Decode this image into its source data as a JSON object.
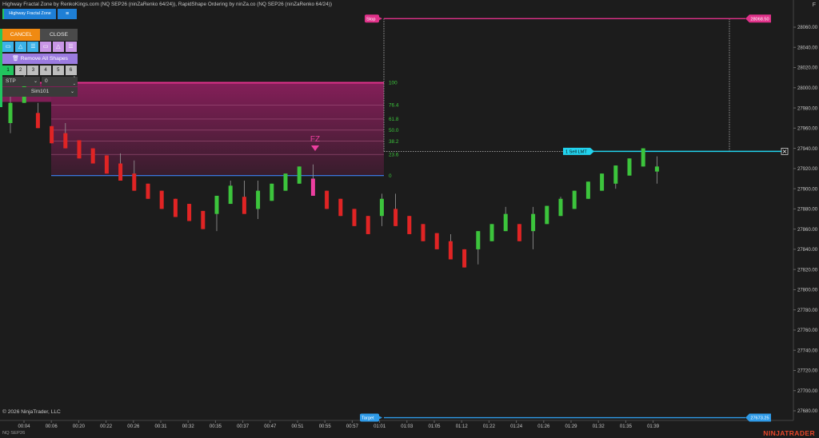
{
  "header": {
    "indicators_line": "Highway Fractal Zone by RenkoKings.com (NQ SEP26 (ninZaRenko 64/24)), RapidShape Ordering by ninZa.co (NQ SEP26 (ninZaRenko 64/24))",
    "corner_label": "F"
  },
  "panel": {
    "hfz_label": "Highway Fractal Zone",
    "hfz_menu_icon": "hamburger-icon",
    "cancel_label": "CANCEL",
    "close_label": "CLOSE",
    "tools": [
      {
        "icon": "rectangle-icon",
        "color": "#3bb2e8"
      },
      {
        "icon": "triangle-icon",
        "color": "#3bb2e8"
      },
      {
        "icon": "lines-icon",
        "color": "#3bb2e8"
      },
      {
        "icon": "rectangle-icon",
        "color": "#c996e6"
      },
      {
        "icon": "triangle-icon",
        "color": "#c996e6"
      },
      {
        "icon": "lines-icon",
        "color": "#c996e6"
      }
    ],
    "remove_label": "Remove All Shapes",
    "numbers": [
      "1",
      "2",
      "3",
      "4",
      "5",
      "6"
    ],
    "active_number": "1",
    "order_type": "STP",
    "quantity": "0",
    "account": "Sim101"
  },
  "footer": {
    "copyright": "© 2026 NinjaTrader, LLC",
    "instrument": "NQ SEP26",
    "brand": "NINJATRADER"
  },
  "chart_data": {
    "type": "renko",
    "instrument": "NQ SEP26",
    "y_axis": {
      "min": 27680,
      "max": 28080,
      "ticks": [
        28060,
        28040,
        28020,
        28000,
        27980,
        27960,
        27940,
        27920,
        27900,
        27880,
        27860,
        27840,
        27820,
        27800,
        27780,
        27760,
        27740,
        27720,
        27700,
        27680
      ],
      "tick_labels": [
        "28060.00",
        "28040.00",
        "28020.00",
        "28000.00",
        "27980.00",
        "27960.00",
        "27940.00",
        "27920.00",
        "27900.00",
        "27880.00",
        "27860.00",
        "27840.00",
        "27820.00",
        "27800.00",
        "27780.00",
        "27760.00",
        "27740.00",
        "27720.00",
        "27700.00",
        "27680.00"
      ]
    },
    "x_tick_labels": [
      "00:04",
      "00:06",
      "00:20",
      "00:22",
      "00:26",
      "00:31",
      "00:32",
      "00:35",
      "00:37",
      "00:47",
      "00:51",
      "00:55",
      "00:57",
      "01:01",
      "01:03",
      "01:05",
      "01:12",
      "01:22",
      "01:24",
      "01:26",
      "01:29",
      "01:32",
      "01:35",
      "01:39"
    ],
    "bars": [
      {
        "d": "up",
        "o": 27965,
        "c": 27985,
        "h": 27995,
        "l": 27955
      },
      {
        "d": "up",
        "o": 27985,
        "c": 28005,
        "h": 28015,
        "l": 27985
      },
      {
        "d": "down",
        "o": 27975,
        "c": 27960,
        "h": 27985,
        "l": 27960
      },
      {
        "d": "down",
        "o": 27962,
        "c": 27945,
        "h": 27962,
        "l": 27945
      },
      {
        "d": "down",
        "o": 27955,
        "c": 27940,
        "h": 27965,
        "l": 27940
      },
      {
        "d": "down",
        "o": 27948,
        "c": 27930,
        "h": 27948,
        "l": 27930
      },
      {
        "d": "down",
        "o": 27940,
        "c": 27925,
        "h": 27940,
        "l": 27925
      },
      {
        "d": "down",
        "o": 27933,
        "c": 27915,
        "h": 27933,
        "l": 27915
      },
      {
        "d": "down",
        "o": 27925,
        "c": 27908,
        "h": 27935,
        "l": 27908
      },
      {
        "d": "down",
        "o": 27915,
        "c": 27898,
        "h": 27928,
        "l": 27898
      },
      {
        "d": "down",
        "o": 27905,
        "c": 27890,
        "h": 27905,
        "l": 27890
      },
      {
        "d": "down",
        "o": 27898,
        "c": 27880,
        "h": 27898,
        "l": 27880
      },
      {
        "d": "down",
        "o": 27890,
        "c": 27872,
        "h": 27890,
        "l": 27872
      },
      {
        "d": "down",
        "o": 27885,
        "c": 27868,
        "h": 27885,
        "l": 27868
      },
      {
        "d": "down",
        "o": 27878,
        "c": 27860,
        "h": 27878,
        "l": 27860
      },
      {
        "d": "up",
        "o": 27875,
        "c": 27893,
        "h": 27893,
        "l": 27858
      },
      {
        "d": "up",
        "o": 27885,
        "c": 27903,
        "h": 27908,
        "l": 27885
      },
      {
        "d": "down",
        "o": 27892,
        "c": 27875,
        "h": 27908,
        "l": 27875
      },
      {
        "d": "up",
        "o": 27880,
        "c": 27898,
        "h": 27908,
        "l": 27870
      },
      {
        "d": "up",
        "o": 27888,
        "c": 27905,
        "h": 27905,
        "l": 27888
      },
      {
        "d": "up",
        "o": 27898,
        "c": 27915,
        "h": 27915,
        "l": 27898
      },
      {
        "d": "up",
        "o": 27905,
        "c": 27922,
        "h": 27922,
        "l": 27905
      },
      {
        "d": "down",
        "o": 27910,
        "c": 27893,
        "h": 27924,
        "l": 27893,
        "pink": true
      },
      {
        "d": "down",
        "o": 27898,
        "c": 27880,
        "h": 27898,
        "l": 27880
      },
      {
        "d": "down",
        "o": 27890,
        "c": 27873,
        "h": 27890,
        "l": 27873
      },
      {
        "d": "down",
        "o": 27880,
        "c": 27863,
        "h": 27880,
        "l": 27863
      },
      {
        "d": "down",
        "o": 27873,
        "c": 27855,
        "h": 27873,
        "l": 27855
      },
      {
        "d": "up",
        "o": 27873,
        "c": 27890,
        "h": 27895,
        "l": 27863
      },
      {
        "d": "down",
        "o": 27880,
        "c": 27863,
        "h": 27895,
        "l": 27863
      },
      {
        "d": "down",
        "o": 27873,
        "c": 27855,
        "h": 27873,
        "l": 27855
      },
      {
        "d": "down",
        "o": 27865,
        "c": 27848,
        "h": 27865,
        "l": 27848
      },
      {
        "d": "down",
        "o": 27856,
        "c": 27840,
        "h": 27856,
        "l": 27840
      },
      {
        "d": "down",
        "o": 27848,
        "c": 27830,
        "h": 27855,
        "l": 27830
      },
      {
        "d": "down",
        "o": 27840,
        "c": 27822,
        "h": 27840,
        "l": 27822
      },
      {
        "d": "up",
        "o": 27840,
        "c": 27858,
        "h": 27858,
        "l": 27825
      },
      {
        "d": "up",
        "o": 27848,
        "c": 27865,
        "h": 27865,
        "l": 27848
      },
      {
        "d": "up",
        "o": 27858,
        "c": 27875,
        "h": 27882,
        "l": 27858
      },
      {
        "d": "down",
        "o": 27865,
        "c": 27848,
        "h": 27865,
        "l": 27848
      },
      {
        "d": "up",
        "o": 27858,
        "c": 27875,
        "h": 27882,
        "l": 27840
      },
      {
        "d": "up",
        "o": 27865,
        "c": 27883,
        "h": 27883,
        "l": 27865
      },
      {
        "d": "up",
        "o": 27873,
        "c": 27890,
        "h": 27892,
        "l": 27873
      },
      {
        "d": "up",
        "o": 27880,
        "c": 27898,
        "h": 27898,
        "l": 27880
      },
      {
        "d": "up",
        "o": 27890,
        "c": 27907,
        "h": 27907,
        "l": 27890
      },
      {
        "d": "up",
        "o": 27898,
        "c": 27915,
        "h": 27915,
        "l": 27898
      },
      {
        "d": "up",
        "o": 27905,
        "c": 27923,
        "h": 27923,
        "l": 27900
      },
      {
        "d": "up",
        "o": 27913,
        "c": 27930,
        "h": 27930,
        "l": 27913
      },
      {
        "d": "up",
        "o": 27922,
        "c": 27940,
        "h": 27940,
        "l": 27922
      },
      {
        "d": "up",
        "o": 27917,
        "c": 27922,
        "h": 27932,
        "l": 27905
      }
    ],
    "fractal_zone": {
      "label": "FZ",
      "levels": [
        {
          "label": "100",
          "price": 28005
        },
        {
          "label": "76.4",
          "price": 27983
        },
        {
          "label": "61.8",
          "price": 27969
        },
        {
          "label": "50.0",
          "price": 27958
        },
        {
          "label": "38.2",
          "price": 27947
        },
        {
          "label": "23.6",
          "price": 27934
        },
        {
          "label": "0",
          "price": 27913
        }
      ],
      "zone_color": "#8a1f5c",
      "top_line_color": "#e0328a",
      "zero_line_color": "#3b82f6"
    },
    "orders": {
      "stop": {
        "label": "Stop",
        "price": 28068.5,
        "price_label": "28068.50",
        "color": "#e0328a"
      },
      "entry": {
        "label": "1  Sell LMT",
        "price": 27937,
        "color": "#22d3ee"
      },
      "target": {
        "label": "Target",
        "price": 27673.25,
        "price_label": "27673.25",
        "color": "#2f9be8"
      }
    },
    "colors": {
      "up": "#3cc43c",
      "down": "#e02424",
      "pink_bar": "#ec3fa0",
      "background": "#1c1c1c",
      "grid": "#2a2a2a"
    }
  }
}
